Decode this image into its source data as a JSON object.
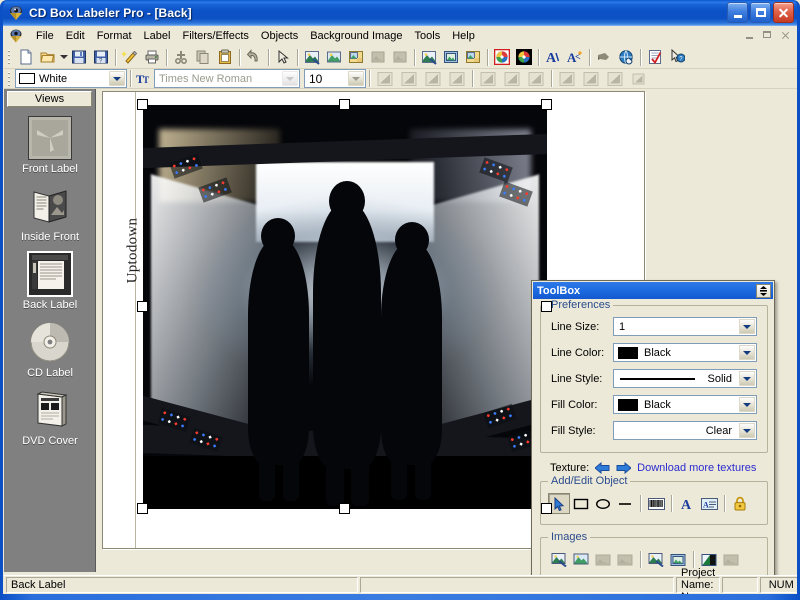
{
  "window": {
    "title": "CD Box Labeler Pro - [Back]",
    "app_icon": "app-logo-icon",
    "buttons": {
      "minimize": "Minimize",
      "maximize": "Maximize",
      "close": "Close"
    }
  },
  "mdi": {
    "minimize": "Minimize",
    "restore": "Restore",
    "close": "Close"
  },
  "menubar": {
    "items": [
      {
        "label": "File"
      },
      {
        "label": "Edit"
      },
      {
        "label": "Format"
      },
      {
        "label": "Label"
      },
      {
        "label": "Filters/Effects"
      },
      {
        "label": "Objects"
      },
      {
        "label": "Background Image"
      },
      {
        "label": "Tools"
      },
      {
        "label": "Help"
      }
    ]
  },
  "toolbar_main": {
    "buttons": [
      {
        "name": "new-icon",
        "title": "New"
      },
      {
        "name": "open-icon",
        "title": "Open"
      },
      {
        "name": "open-dropdown-icon",
        "title": "Open recent"
      },
      {
        "name": "save-icon",
        "title": "Save"
      },
      {
        "name": "save-as-icon",
        "title": "Save As"
      },
      {
        "name": "wizard-icon",
        "title": "Wizard"
      },
      {
        "name": "print-icon",
        "title": "Print"
      },
      {
        "name": "cut-icon",
        "title": "Cut"
      },
      {
        "name": "copy-icon",
        "title": "Copy"
      },
      {
        "name": "paste-icon",
        "title": "Paste"
      },
      {
        "name": "undo-icon",
        "title": "Undo"
      },
      {
        "name": "select-arrow-icon",
        "title": "Select"
      },
      {
        "name": "insert-image-icon",
        "title": "Insert Image"
      },
      {
        "name": "background-image-icon",
        "title": "Background Image"
      },
      {
        "name": "image-folder-icon",
        "title": "Image Folder"
      },
      {
        "name": "image-remove-icon",
        "title": "Remove Image"
      },
      {
        "name": "image-remove2-icon",
        "title": "Remove Background"
      },
      {
        "name": "image-effects-icon",
        "title": "Image Effects"
      },
      {
        "name": "image-frame-icon",
        "title": "Image Frame"
      },
      {
        "name": "image-export-icon",
        "title": "Export Image"
      },
      {
        "name": "cd-red-icon",
        "title": "CD Label Red"
      },
      {
        "name": "cd-black-icon",
        "title": "CD Label Black"
      },
      {
        "name": "text-tool-icon",
        "title": "Add Text"
      },
      {
        "name": "text-effects-icon",
        "title": "Text Effects"
      },
      {
        "name": "cursor-hand-icon",
        "title": "Pointer"
      },
      {
        "name": "internet-icon",
        "title": "Internet / CDDB"
      },
      {
        "name": "checklist-icon",
        "title": "Track List"
      },
      {
        "name": "help-arrow-icon",
        "title": "What's This Help"
      }
    ]
  },
  "toolbar_format": {
    "color": {
      "value": "White",
      "swatch": "#FFFFFF"
    },
    "font": {
      "value": "Times New Roman",
      "icon": "font-icon",
      "disabled": true
    },
    "size": {
      "value": "10",
      "disabled": true
    },
    "align_buttons": [
      {
        "name": "align-left-icon"
      },
      {
        "name": "align-center-icon"
      },
      {
        "name": "align-right-icon"
      },
      {
        "name": "align-justify-icon"
      },
      {
        "name": "align-top-icon"
      },
      {
        "name": "align-middle-icon"
      },
      {
        "name": "align-bottom-icon"
      },
      {
        "name": "bring-front-icon"
      },
      {
        "name": "send-back-icon"
      },
      {
        "name": "group-icon"
      },
      {
        "name": "ungroup-icon"
      }
    ]
  },
  "views": {
    "header": "Views",
    "items": [
      {
        "label": "Front Label",
        "icon": "front-label-icon",
        "selected": false
      },
      {
        "label": "Inside Front",
        "icon": "inside-front-icon",
        "selected": false
      },
      {
        "label": "Back Label",
        "icon": "back-label-icon",
        "selected": true
      },
      {
        "label": "CD Label",
        "icon": "cd-label-icon",
        "selected": false
      },
      {
        "label": "DVD Cover",
        "icon": "dvd-cover-icon",
        "selected": false
      }
    ]
  },
  "document": {
    "side_text": "Uptodown",
    "image_alt": "stage-photo-three-dancers-silhouette"
  },
  "toolbox": {
    "title": "ToolBox",
    "rollup_button": "roll-up",
    "preferences": {
      "legend": "Preferences",
      "fields": [
        {
          "label": "Line Size:",
          "value": "1",
          "kind": "text"
        },
        {
          "label": "Line Color:",
          "value": "Black",
          "kind": "color",
          "swatch": "#000000"
        },
        {
          "label": "Line Style:",
          "value": "Solid",
          "kind": "line"
        },
        {
          "label": "Fill Color:",
          "value": "Black",
          "kind": "color",
          "swatch": "#000000"
        },
        {
          "label": "Fill Style:",
          "value": "Clear",
          "kind": "right"
        }
      ],
      "texture_label": "Texture:",
      "texture_prev": "previous-texture",
      "texture_next": "next-texture",
      "texture_link": "Download more textures",
      "link_color": "#2A2AD0"
    },
    "add_edit_object": {
      "legend": "Add/Edit Object",
      "buttons": [
        {
          "name": "select-tool-icon",
          "pressed": true
        },
        {
          "name": "rectangle-tool-icon",
          "pressed": false
        },
        {
          "name": "ellipse-tool-icon",
          "pressed": false
        },
        {
          "name": "line-tool-icon",
          "pressed": false
        },
        {
          "name": "barcode-tool-icon",
          "pressed": false
        },
        {
          "name": "text-tool-icon",
          "pressed": false
        },
        {
          "name": "text-box-tool-icon",
          "pressed": false
        },
        {
          "name": "lock-tool-icon",
          "pressed": false
        }
      ]
    },
    "images": {
      "legend": "Images",
      "buttons": [
        {
          "name": "insert-image-icon",
          "disabled": false
        },
        {
          "name": "picture-icon",
          "disabled": false
        },
        {
          "name": "image-placeholder-icon",
          "disabled": true
        },
        {
          "name": "image-placeholder2-icon",
          "disabled": true
        },
        {
          "name": "background-image-icon",
          "disabled": false
        },
        {
          "name": "image-frame-icon",
          "disabled": false
        },
        {
          "name": "image-crop-icon",
          "disabled": false
        },
        {
          "name": "image-delete-icon",
          "disabled": true
        }
      ]
    }
  },
  "statusbar": {
    "panes": [
      {
        "text": "Back Label"
      },
      {
        "text": ""
      },
      {
        "text": "Project Name: None"
      },
      {
        "text": ""
      },
      {
        "text": "NUM"
      }
    ]
  },
  "colors": {
    "title_blue": "#0C50C4",
    "face": "#ECE9D8",
    "sidebar_gray": "#808080",
    "canvas_black": "#000000"
  }
}
